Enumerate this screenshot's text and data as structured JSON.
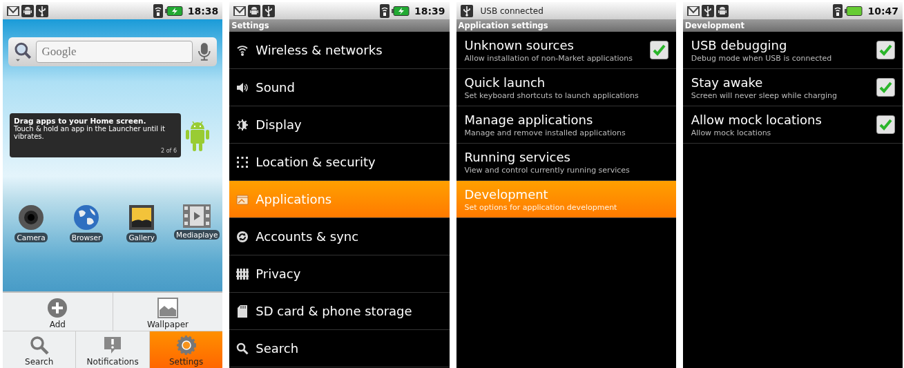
{
  "screens": [
    {
      "kind": "home",
      "status_bar": {
        "time": "18:38",
        "charging": true
      },
      "search": {
        "placeholder": "Google"
      },
      "tooltip": {
        "title": "Drag apps to your Home screen.",
        "body": "Touch & hold an app in the Launcher until it vibrates.",
        "page": "2 of 6"
      },
      "apps": [
        "Camera",
        "Browser",
        "Gallery",
        "Mediaplaye"
      ],
      "menu": [
        [
          {
            "label": "Add",
            "selected": false
          },
          {
            "label": "Wallpaper",
            "selected": false
          }
        ],
        [
          {
            "label": "Search",
            "selected": false
          },
          {
            "label": "Notifications",
            "selected": false
          },
          {
            "label": "Settings",
            "selected": true
          }
        ]
      ]
    },
    {
      "kind": "list",
      "status_bar": {
        "time": "18:39",
        "charging": true
      },
      "title": "Settings",
      "items": [
        {
          "title": "Wireless & networks",
          "selected": false
        },
        {
          "title": "Sound",
          "selected": false
        },
        {
          "title": "Display",
          "selected": false
        },
        {
          "title": "Location & security",
          "selected": false
        },
        {
          "title": "Applications",
          "selected": true
        },
        {
          "title": "Accounts & sync",
          "selected": false
        },
        {
          "title": "Privacy",
          "selected": false
        },
        {
          "title": "SD card & phone storage",
          "selected": false
        },
        {
          "title": "Search",
          "selected": false
        }
      ]
    },
    {
      "kind": "prefs",
      "status_bar": {
        "ticker": "USB connected"
      },
      "title": "Application settings",
      "items": [
        {
          "kind": "checkbox",
          "title": "Unknown sources",
          "summary": "Allow installation of non-Market applications",
          "checked": true,
          "selected": false
        },
        {
          "kind": "plain",
          "title": "Quick launch",
          "summary": "Set keyboard shortcuts to launch applications",
          "selected": false
        },
        {
          "kind": "plain",
          "title": "Manage applications",
          "summary": "Manage and remove installed applications",
          "selected": false
        },
        {
          "kind": "plain",
          "title": "Running services",
          "summary": "View and control currently running services",
          "selected": false
        },
        {
          "kind": "plain",
          "title": "Development",
          "summary": "Set options for application development",
          "selected": true
        }
      ]
    },
    {
      "kind": "prefs",
      "status_bar": {
        "time": "10:47",
        "charging": false
      },
      "title": "Development",
      "items": [
        {
          "kind": "checkbox",
          "title": "USB debugging",
          "summary": "Debug mode when USB is connected",
          "checked": true,
          "selected": false
        },
        {
          "kind": "checkbox",
          "title": "Stay awake",
          "summary": "Screen will never sleep while charging",
          "checked": true,
          "selected": false
        },
        {
          "kind": "checkbox",
          "title": "Allow mock locations",
          "summary": "Allow mock locations",
          "checked": true,
          "selected": false
        }
      ]
    }
  ]
}
